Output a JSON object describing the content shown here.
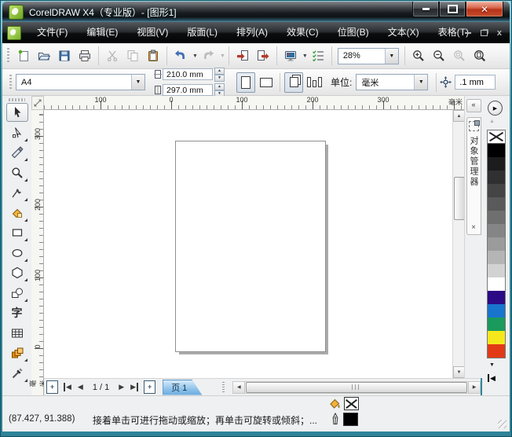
{
  "window": {
    "title": "CorelDRAW X4（专业版）- [图形1]"
  },
  "menu": {
    "items": [
      "文件(F)",
      "编辑(E)",
      "视图(V)",
      "版面(L)",
      "排列(A)",
      "效果(C)",
      "位图(B)",
      "文本(X)",
      "表格(T)"
    ]
  },
  "toolbar": {
    "zoom_level": "28%"
  },
  "property_bar": {
    "paper_type": "A4",
    "paper_width": "210.0 mm",
    "paper_height": "297.0 mm",
    "units_label": "单位:",
    "units_value": "毫米",
    "nudge_offset": ".1 mm"
  },
  "rulers": {
    "h_labels": [
      "100",
      "0",
      "100",
      "200",
      "300"
    ],
    "h_unit": "毫米",
    "v_labels": [
      "300",
      "200",
      "100",
      "0"
    ],
    "v_unit": "毫米"
  },
  "toolbox": {
    "text_tool_glyph": "字"
  },
  "docker": {
    "tab_label": "对象管理器"
  },
  "palette": {
    "swatches": [
      "none",
      "#000000",
      "#1c1c1c",
      "#303030",
      "#454545",
      "#5a5a5a",
      "#6f6f6f",
      "#858585",
      "#9b9b9b",
      "#b5b5b5",
      "#d2d2d2",
      "#ffffff",
      "#2b0a85",
      "#1874cd",
      "#1a9a5c",
      "#f4e81c",
      "#e23a17"
    ]
  },
  "page_nav": {
    "counter": "1 / 1",
    "tab_label": "页 1"
  },
  "status": {
    "coords": "(87.427, 91.388)",
    "hint": "接着单击可进行拖动或缩放；再单击可旋转或倾斜；..."
  }
}
